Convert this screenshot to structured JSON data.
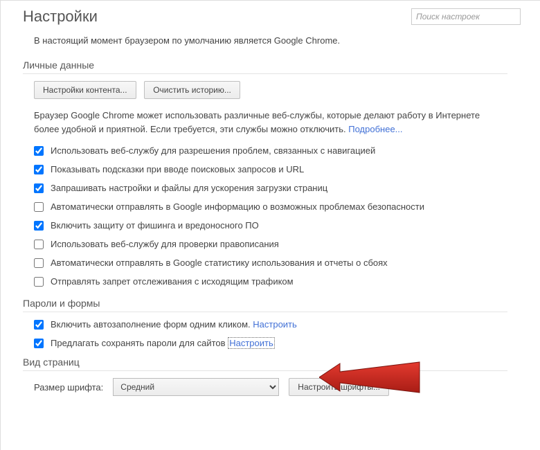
{
  "header": {
    "title": "Настройки",
    "search_placeholder": "Поиск настроек"
  },
  "default_browser_line": "В настоящий момент браузером по умолчанию является Google Chrome.",
  "privacy": {
    "heading": "Личные данные",
    "content_settings_btn": "Настройки контента...",
    "clear_history_btn": "Очистить историю...",
    "description_pre": "Браузер Google Chrome может использовать различные веб-службы, которые делают работу в Интернете более удобной и приятной. Если требуется, эти службы можно отключить.",
    "learn_more": "Подробнее...",
    "options": [
      {
        "label": "Использовать веб-службу для разрешения проблем, связанных с навигацией",
        "checked": true
      },
      {
        "label": "Показывать подсказки при вводе поисковых запросов и URL",
        "checked": true
      },
      {
        "label": "Запрашивать настройки и файлы для ускорения загрузки страниц",
        "checked": true
      },
      {
        "label": "Автоматически отправлять в Google информацию о возможных проблемах безопасности",
        "checked": false
      },
      {
        "label": "Включить защиту от фишинга и вредоносного ПО",
        "checked": true
      },
      {
        "label": "Использовать веб-службу для проверки правописания",
        "checked": false
      },
      {
        "label": "Автоматически отправлять в Google статистику использования и отчеты о сбоях",
        "checked": false
      },
      {
        "label": "Отправлять запрет отслеживания с исходящим трафиком",
        "checked": false
      }
    ]
  },
  "passwords": {
    "heading": "Пароли и формы",
    "autofill_label": "Включить автозаполнение форм одним кликом.",
    "autofill_link": "Настроить",
    "save_label": "Предлагать сохранять пароли для сайтов",
    "save_link": "Настроить"
  },
  "appearance": {
    "heading": "Вид страниц",
    "font_size_label": "Размер шрифта:",
    "font_size_value": "Средний",
    "customize_fonts_btn": "Настроить шрифты..."
  }
}
